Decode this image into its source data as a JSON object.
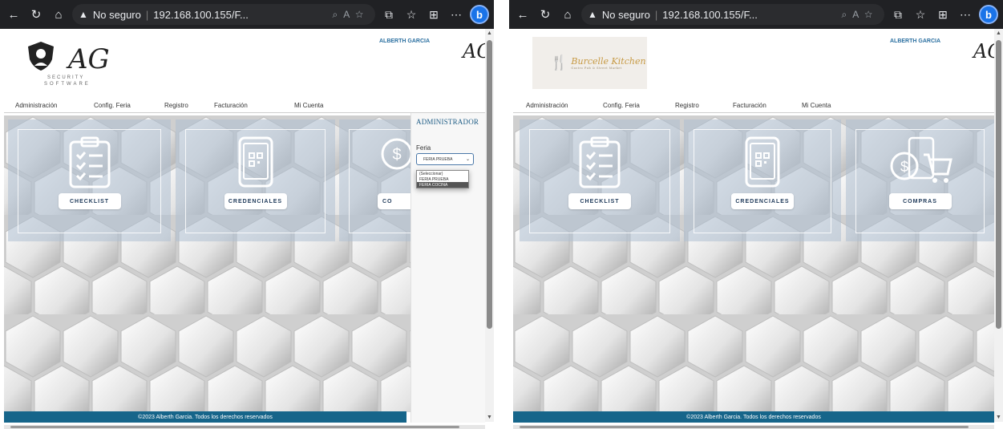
{
  "browser": {
    "security_label": "No seguro",
    "url": "192.168.100.155/F..."
  },
  "header": {
    "user_name": "ALBERTH GARCIA"
  },
  "logo_security": {
    "mark": "AG",
    "line1": "SECURITY",
    "line2": "SOFTWARE"
  },
  "logo_brand": {
    "utensils": "🍴",
    "name": "Burcelle Kitchen",
    "tagline": "Gastro Pub & Street Market"
  },
  "menu": {
    "items": [
      "Administración",
      "Config. Feria",
      "Registro",
      "Facturación",
      "Mi Cuenta"
    ]
  },
  "cards": {
    "checklist": "CHECKLIST",
    "credenciales": "CREDENCIALES",
    "compras": "COMPRAS",
    "compras_cut": "CO"
  },
  "admin": {
    "title": "ADMINISTRADOR",
    "feria_label": "Feria",
    "selected": "FERIA PRUEBA",
    "options": [
      "(Seleccionar)",
      "FERIA PRUEBA",
      "FERIA COCINA"
    ],
    "highlighted_option": "FERIA COCINA"
  },
  "footer": {
    "text": "©2023 Alberth Garcia. Todos los derechos reservados"
  },
  "colors": {
    "footer": "#16658a",
    "card_overlay": "#aec0d2",
    "accent": "#1f5d86"
  }
}
